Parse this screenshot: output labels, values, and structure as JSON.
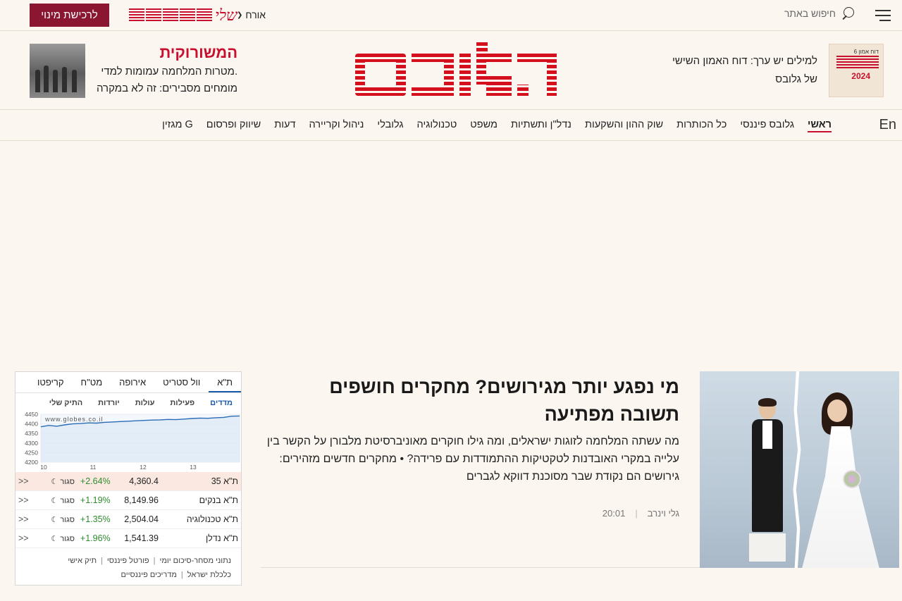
{
  "topbar": {
    "subscribe_label": "לרכישת מינוי",
    "my_globes_label": "שלי",
    "user_label": "אורח",
    "search_label": "חיפוש באתר"
  },
  "header": {
    "promo_right": {
      "thumb_small": "דוח אמון 6",
      "thumb_year": "2024",
      "line1": "למילים יש ערך: דוח האמון השישי",
      "line2": "של גלובס"
    },
    "promo_left": {
      "tag": "המשורוקית",
      "line1": "מטרות המלחמה עמומות למדי.",
      "line2": "מומחים מסבירים: זה לא במקרה"
    }
  },
  "nav": {
    "items": [
      "ראשי",
      "גלובס פיננסי",
      "כל הכותרות",
      "שוק ההון והשקעות",
      "נדל\"ן ותשתיות",
      "משפט",
      "טכנולוגיה",
      "גלובלי",
      "ניהול וקריירה",
      "דעות",
      "שיווק ופרסום",
      "מגזין G"
    ],
    "en_label": "En"
  },
  "article": {
    "title": "מי נפגע יותר מגירושים? מחקרים חושפים תשובה מפתיעה",
    "subtitle": "מה עשתה המלחמה לזוגות ישראלים, ומה גילו חוקרים מאוניברסיטת מלבורן על הקשר בין עלייה במקרי האובדנות לטקטיקות ההתמודדות עם פרידה? • מחקרים חדשים מזהירים: גירושים הם נקודת שבר מסוכנת דווקא לגברים",
    "author": "גלי וינרב",
    "time": "20:01"
  },
  "market": {
    "tabs": [
      "ת\"א",
      "וול סטריט",
      "אירופה",
      "מט\"ח",
      "קריפטו"
    ],
    "subtabs": [
      "מדדים",
      "פעילות",
      "עולות",
      "יורדות",
      "התיק שלי"
    ],
    "chart_watermark": "www.globes.co.il",
    "rows": [
      {
        "name": "ת\"א 35",
        "value": "4,360.4",
        "change": "+2.64%",
        "status": "סגור",
        "arrow": ">>"
      },
      {
        "name": "ת\"א בנקים",
        "value": "8,149.96",
        "change": "+1.19%",
        "status": "סגור",
        "arrow": ">>"
      },
      {
        "name": "ת\"א טכנולוגיה",
        "value": "2,504.04",
        "change": "+1.35%",
        "status": "סגור",
        "arrow": ">>"
      },
      {
        "name": "ת\"א נדלן",
        "value": "1,541.39",
        "change": "+1.96%",
        "status": "סגור",
        "arrow": ">>"
      }
    ],
    "links_line1": [
      "נתוני מסחר-סיכום יומי",
      "פורטל פיננסי",
      "תיק אישי"
    ],
    "links_line2": [
      "כלכלת ישראל",
      "מדריכים פיננסיים"
    ]
  },
  "chart_data": {
    "type": "line",
    "x_ticks": [
      "10",
      "11",
      "12",
      "13"
    ],
    "y_ticks": [
      "4450",
      "4400",
      "4350",
      "4300",
      "4250",
      "4200"
    ],
    "ylim": [
      4200,
      4450
    ],
    "values": [
      4385,
      4392,
      4388,
      4395,
      4400,
      4402,
      4405,
      4404,
      4408,
      4410,
      4412,
      4414,
      4416,
      4418,
      4420,
      4421,
      4423,
      4422,
      4425,
      4428,
      4430,
      4429,
      4432,
      4434,
      4440,
      4441
    ]
  }
}
